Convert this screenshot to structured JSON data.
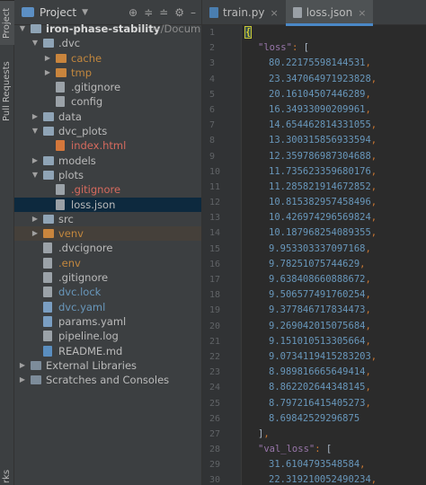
{
  "sidebar_strip": {
    "project_tab": "Project",
    "pull_requests_tab": "Pull Requests",
    "bottom_tab": "rks"
  },
  "project_panel": {
    "title": "Project",
    "tree": [
      {
        "label": "iron-phase-stability",
        "extra": "~/Documents/D:",
        "depth": 0,
        "arrow": "down",
        "icon": "folder",
        "style": "root"
      },
      {
        "label": ".dvc",
        "depth": 1,
        "arrow": "down",
        "icon": "folder",
        "style": "default"
      },
      {
        "label": "cache",
        "depth": 2,
        "arrow": "right",
        "icon": "folder-orange",
        "style": "ignored"
      },
      {
        "label": "tmp",
        "depth": 2,
        "arrow": "right",
        "icon": "folder-orange",
        "style": "ignored"
      },
      {
        "label": ".gitignore",
        "depth": 2,
        "arrow": "",
        "icon": "file",
        "style": "default"
      },
      {
        "label": "config",
        "depth": 2,
        "arrow": "",
        "icon": "file",
        "style": "default"
      },
      {
        "label": "data",
        "depth": 1,
        "arrow": "right",
        "icon": "folder",
        "style": "default"
      },
      {
        "label": "dvc_plots",
        "depth": 1,
        "arrow": "down",
        "icon": "folder",
        "style": "default"
      },
      {
        "label": "index.html",
        "depth": 2,
        "arrow": "",
        "icon": "file-html",
        "style": "red"
      },
      {
        "label": "models",
        "depth": 1,
        "arrow": "right",
        "icon": "folder",
        "style": "default"
      },
      {
        "label": "plots",
        "depth": 1,
        "arrow": "down",
        "icon": "folder",
        "style": "default"
      },
      {
        "label": ".gitignore",
        "depth": 2,
        "arrow": "",
        "icon": "file",
        "style": "red"
      },
      {
        "label": "loss.json",
        "depth": 2,
        "arrow": "",
        "icon": "file-json",
        "style": "default",
        "selected": true
      },
      {
        "label": "src",
        "depth": 1,
        "arrow": "right",
        "icon": "folder",
        "style": "default"
      },
      {
        "label": "venv",
        "depth": 1,
        "arrow": "right",
        "icon": "folder-orange",
        "style": "ignored",
        "highlight": true
      },
      {
        "label": ".dvcignore",
        "depth": 1,
        "arrow": "",
        "icon": "file",
        "style": "default"
      },
      {
        "label": ".env",
        "depth": 1,
        "arrow": "",
        "icon": "file",
        "style": "ignored"
      },
      {
        "label": ".gitignore",
        "depth": 1,
        "arrow": "",
        "icon": "file",
        "style": "default"
      },
      {
        "label": "dvc.lock",
        "depth": 1,
        "arrow": "",
        "icon": "file",
        "style": "blue"
      },
      {
        "label": "dvc.yaml",
        "depth": 1,
        "arrow": "",
        "icon": "file-yaml",
        "style": "blue"
      },
      {
        "label": "params.yaml",
        "depth": 1,
        "arrow": "",
        "icon": "file-yaml",
        "style": "default"
      },
      {
        "label": "pipeline.log",
        "depth": 1,
        "arrow": "",
        "icon": "file",
        "style": "default"
      },
      {
        "label": "README.md",
        "depth": 1,
        "arrow": "",
        "icon": "file-md",
        "style": "default"
      },
      {
        "label": "External Libraries",
        "depth": 0,
        "arrow": "right",
        "icon": "lib",
        "style": "default"
      },
      {
        "label": "Scratches and Consoles",
        "depth": 0,
        "arrow": "right",
        "icon": "lib",
        "style": "default"
      }
    ]
  },
  "editor": {
    "tabs": [
      {
        "label": "train.py",
        "icon": "py",
        "active": false
      },
      {
        "label": "loss.json",
        "icon": "json",
        "active": true
      }
    ],
    "close_glyph": "×",
    "lines": [
      {
        "n": "1",
        "text": "{",
        "kind": "brace-open"
      },
      {
        "n": "2",
        "text": "\"loss\": [",
        "kind": "key"
      },
      {
        "n": "3",
        "text": "80.22175598144531,",
        "kind": "num"
      },
      {
        "n": "4",
        "text": "23.347064971923828,",
        "kind": "num"
      },
      {
        "n": "5",
        "text": "20.16104507446289,",
        "kind": "num"
      },
      {
        "n": "6",
        "text": "16.34933090209961,",
        "kind": "num"
      },
      {
        "n": "7",
        "text": "14.654462814331055,",
        "kind": "num"
      },
      {
        "n": "8",
        "text": "13.300315856933594,",
        "kind": "num"
      },
      {
        "n": "9",
        "text": "12.359786987304688,",
        "kind": "num"
      },
      {
        "n": "10",
        "text": "11.735623359680176,",
        "kind": "num"
      },
      {
        "n": "11",
        "text": "11.285821914672852,",
        "kind": "num"
      },
      {
        "n": "12",
        "text": "10.815382957458496,",
        "kind": "num"
      },
      {
        "n": "13",
        "text": "10.426974296569824,",
        "kind": "num"
      },
      {
        "n": "14",
        "text": "10.187968254089355,",
        "kind": "num"
      },
      {
        "n": "15",
        "text": "9.953303337097168,",
        "kind": "num"
      },
      {
        "n": "16",
        "text": "9.78251075744629,",
        "kind": "num"
      },
      {
        "n": "17",
        "text": "9.638408660888672,",
        "kind": "num"
      },
      {
        "n": "18",
        "text": "9.506577491760254,",
        "kind": "num"
      },
      {
        "n": "19",
        "text": "9.377846717834473,",
        "kind": "num"
      },
      {
        "n": "20",
        "text": "9.269042015075684,",
        "kind": "num"
      },
      {
        "n": "21",
        "text": "9.151010513305664,",
        "kind": "num"
      },
      {
        "n": "22",
        "text": "9.0734119415283203,",
        "kind": "num"
      },
      {
        "n": "23",
        "text": "8.989816665649414,",
        "kind": "num"
      },
      {
        "n": "24",
        "text": "8.862202644348145,",
        "kind": "num"
      },
      {
        "n": "25",
        "text": "8.797216415405273,",
        "kind": "num"
      },
      {
        "n": "26",
        "text": "8.69842529296875",
        "kind": "num"
      },
      {
        "n": "27",
        "text": "],",
        "kind": "close"
      },
      {
        "n": "28",
        "text": "\"val_loss\": [",
        "kind": "key"
      },
      {
        "n": "29",
        "text": "31.6104793548584,",
        "kind": "num"
      },
      {
        "n": "30",
        "text": "22.319210052490234,",
        "kind": "num"
      }
    ]
  }
}
